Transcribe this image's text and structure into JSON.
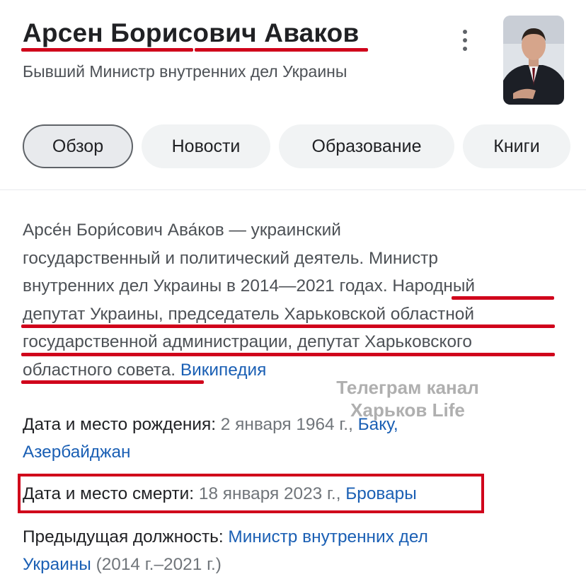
{
  "header": {
    "title": "Арсен Борисович Аваков",
    "subtitle": "Бывший Министр внутренних дел Украины",
    "menu_icon": "kebab-menu-icon",
    "photo_alt": "portrait-photo"
  },
  "tabs": [
    {
      "label": "Обзор",
      "active": true
    },
    {
      "label": "Новости",
      "active": false
    },
    {
      "label": "Образование",
      "active": false
    },
    {
      "label": "Книги",
      "active": false
    }
  ],
  "description": {
    "line1": "Арсе́н Бори́сович Ава́ков — украинский",
    "line2": "государственный и политический деятель. Министр",
    "line3a": "внутренних дел Украины в 2014—2021 годах. ",
    "line3b": "Народный",
    "line4": "депутат Украины, председатель Харьковской областной",
    "line5": "государственной администрации, депутат Харьковского",
    "line6a": "областного совета.",
    "source": "Википедия"
  },
  "facts": {
    "birth_label": "Дата и место рождения:",
    "birth_date": "2 января 1964 г.,",
    "birth_place1": "Баку,",
    "birth_place2": "Азербайджан",
    "death_label": "Дата и место смерти:",
    "death_date": "18 января 2023 г.,",
    "death_place": "Бровары",
    "prev_label": "Предыдущая должность:",
    "prev_value1": "Министр внутренних дел",
    "prev_value2": "Украины",
    "prev_years": "(2014 г.–2021 г.)"
  },
  "watermark": {
    "line1": "Телеграм канал",
    "line2": "Харьков Life"
  },
  "colors": {
    "annotation_red": "#d0021b",
    "link_blue": "#1a5fb4",
    "muted_gray": "#70757a"
  }
}
